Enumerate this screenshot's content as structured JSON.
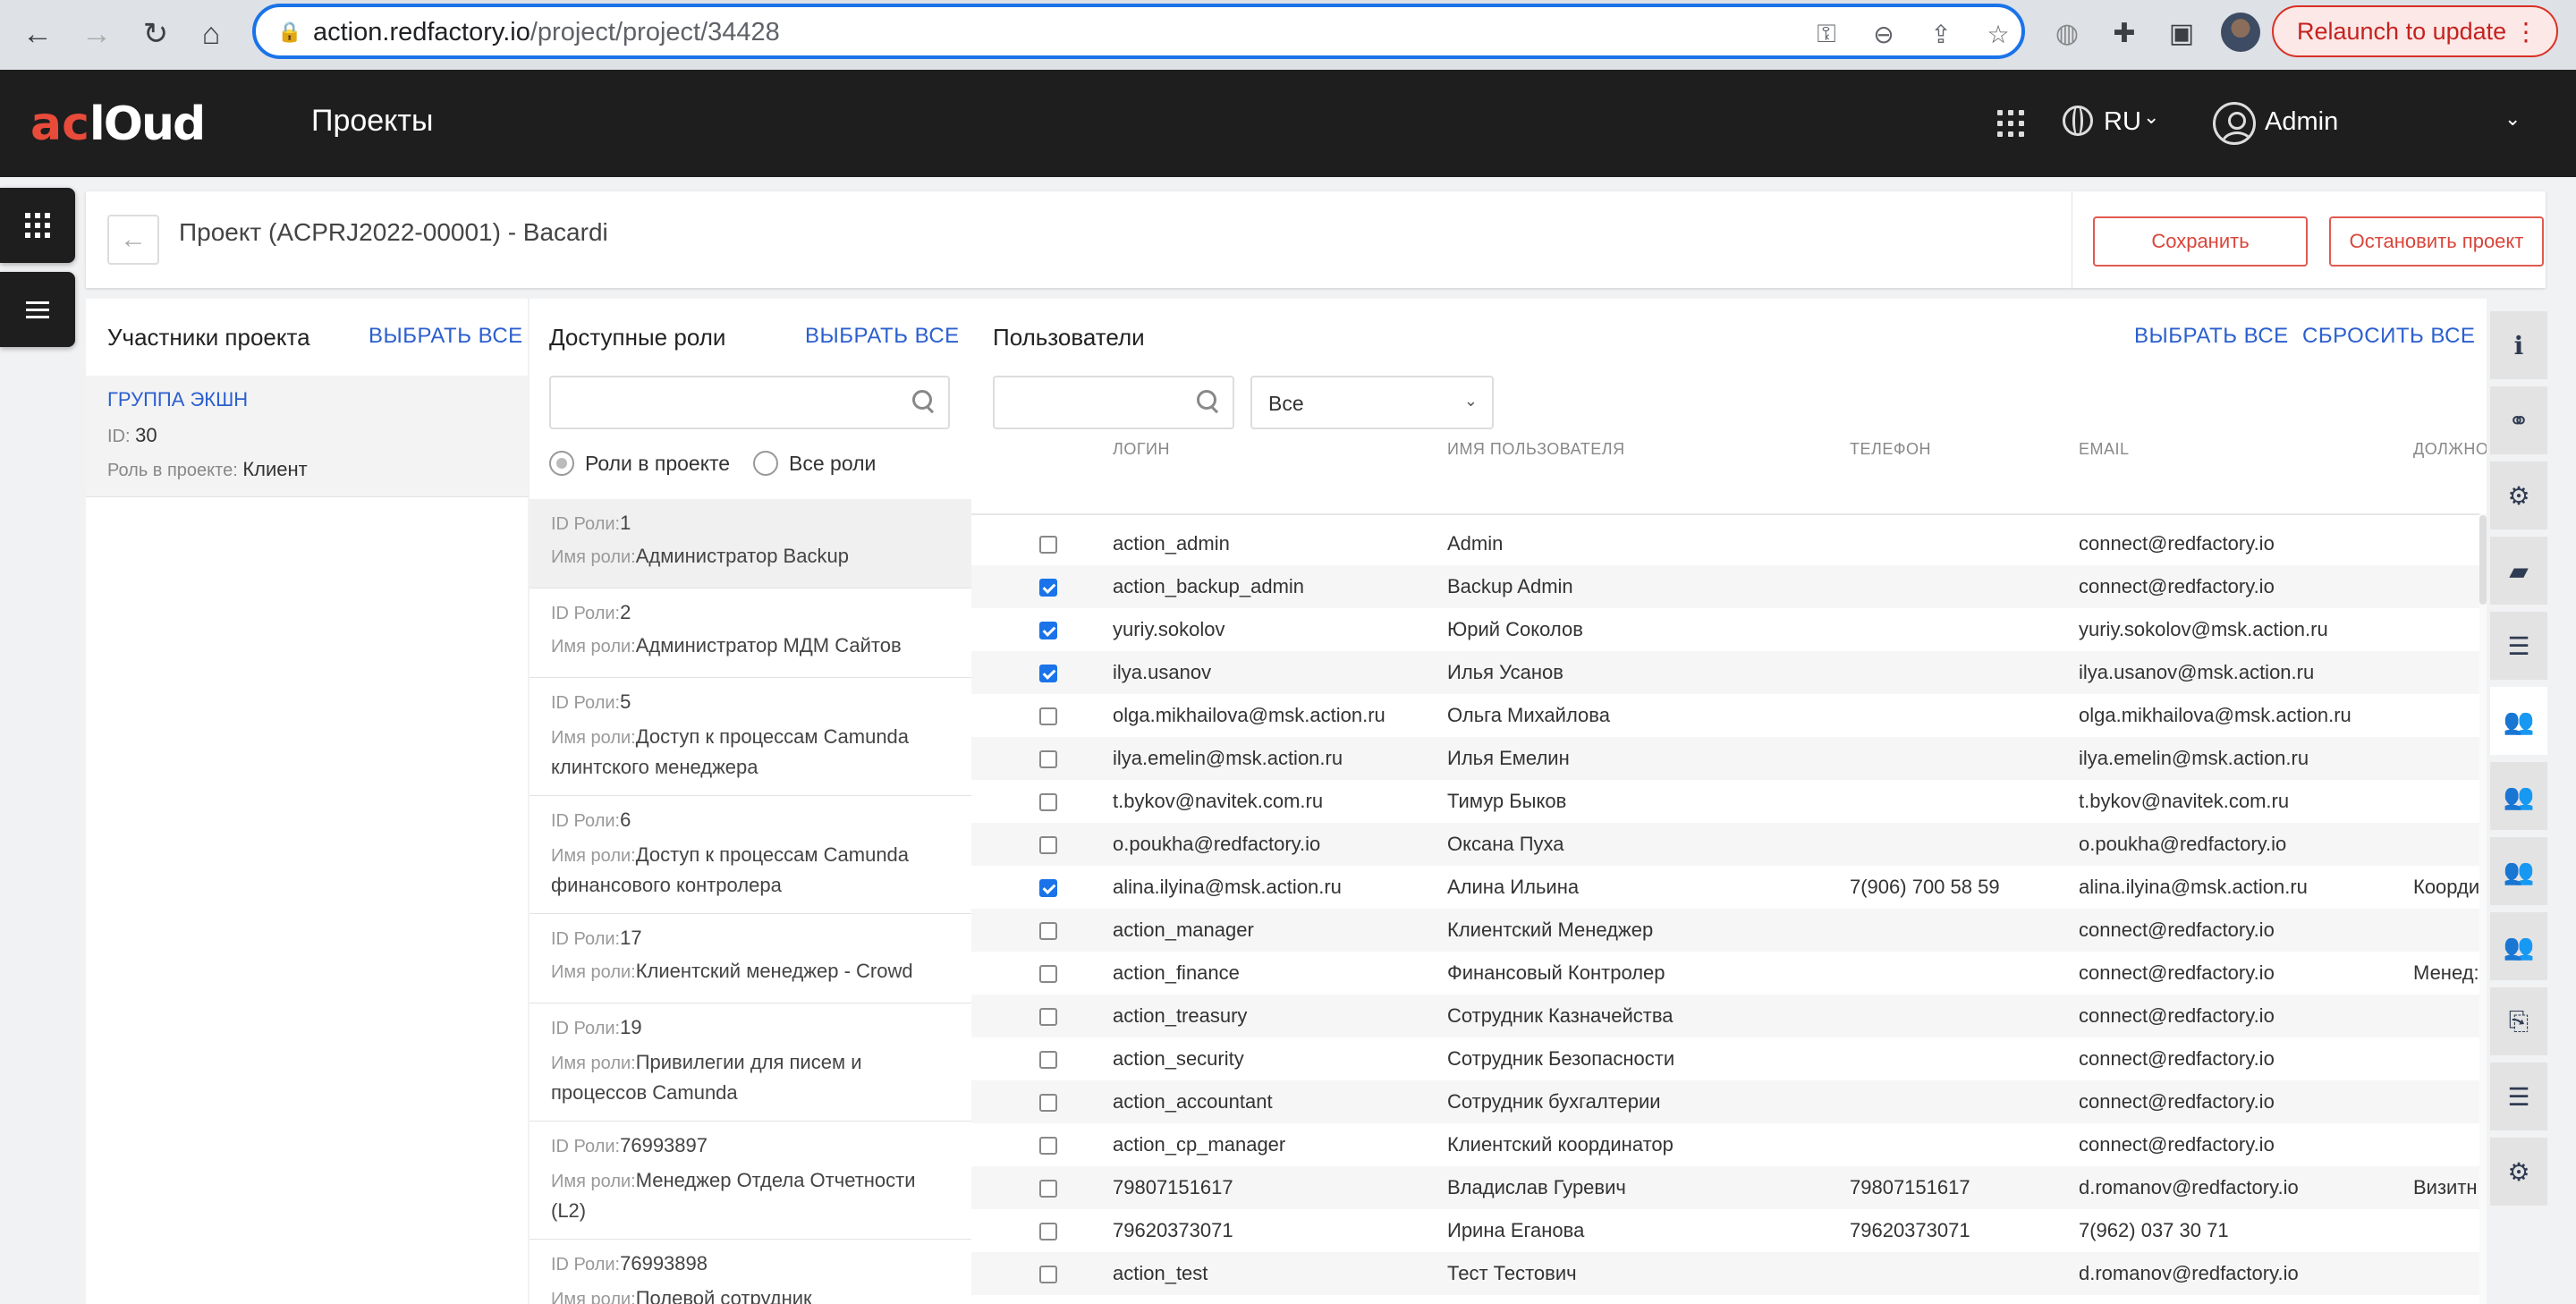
{
  "browser": {
    "url_host": "action.redfactory.io",
    "url_path": "/project/project/34428",
    "relaunch_label": "Relaunch to update"
  },
  "app": {
    "logo_left": "ac",
    "logo_right": "lOud",
    "title": "Проекты",
    "lang": "RU",
    "user": "Admin"
  },
  "page": {
    "title": "Проект (ACPRJ2022-00001) - Bacardi",
    "save_label": "Сохранить",
    "stop_label": "Остановить проект"
  },
  "members": {
    "heading": "Участники проекта",
    "select_all": "ВЫБРАТЬ ВСЕ",
    "items": [
      {
        "name": "ГРУППА ЭКШН",
        "id_label": "ID:",
        "id": "30",
        "role_label": "Роль в проекте:",
        "role": "Клиент"
      }
    ]
  },
  "roles": {
    "heading": "Доступные роли",
    "select_all": "ВЫБРАТЬ ВСЕ",
    "radio_project": "Роли в проекте",
    "radio_all": "Все роли",
    "id_label": "ID Роли:",
    "name_label": "Имя роли:",
    "items": [
      {
        "id": "1",
        "name": "Администратор Backup"
      },
      {
        "id": "2",
        "name": "Администратор МДМ Сайтов"
      },
      {
        "id": "5",
        "name": "Доступ к процессам Camunda клинтского менеджера"
      },
      {
        "id": "6",
        "name": "Доступ к процессам Camunda финансового контролера"
      },
      {
        "id": "17",
        "name": "Клиентский менеджер - Crowd"
      },
      {
        "id": "19",
        "name": "Привилегии для писем и процессов Camunda"
      },
      {
        "id": "76993897",
        "name": "Менеджер Отдела Отчетности (L2)"
      },
      {
        "id": "76993898",
        "name": "Полевой сотрудник"
      }
    ]
  },
  "users": {
    "heading": "Пользователи",
    "select_all": "ВЫБРАТЬ ВСЕ",
    "reset_all": "СБРОСИТЬ ВСЕ",
    "filter_value": "Все",
    "columns": [
      "ЛОГИН",
      "ИМЯ ПОЛЬЗОВАТЕЛЯ",
      "ТЕЛЕФОН",
      "EMAIL",
      "ДОЛЖНО"
    ],
    "rows": [
      {
        "checked": false,
        "login": "action_admin",
        "name": "Admin",
        "phone": "",
        "email": "connect@redfactory.io",
        "position": ""
      },
      {
        "checked": true,
        "login": "action_backup_admin",
        "name": "Backup Admin",
        "phone": "",
        "email": "connect@redfactory.io",
        "position": ""
      },
      {
        "checked": true,
        "login": "yuriy.sokolov",
        "name": "Юрий Соколов",
        "phone": "",
        "email": "yuriy.sokolov@msk.action.ru",
        "position": ""
      },
      {
        "checked": true,
        "login": "ilya.usanov",
        "name": "Илья Усанов",
        "phone": "",
        "email": "ilya.usanov@msk.action.ru",
        "position": ""
      },
      {
        "checked": false,
        "login": "olga.mikhailova@msk.action.ru",
        "name": "Ольга Михайлова",
        "phone": "",
        "email": "olga.mikhailova@msk.action.ru",
        "position": ""
      },
      {
        "checked": false,
        "login": "ilya.emelin@msk.action.ru",
        "name": "Илья Емелин",
        "phone": "",
        "email": "ilya.emelin@msk.action.ru",
        "position": ""
      },
      {
        "checked": false,
        "login": "t.bykov@navitek.com.ru",
        "name": "Тимур Быков",
        "phone": "",
        "email": "t.bykov@navitek.com.ru",
        "position": ""
      },
      {
        "checked": false,
        "login": "o.poukha@redfactory.io",
        "name": "Оксана Пуха",
        "phone": "",
        "email": "o.poukha@redfactory.io",
        "position": ""
      },
      {
        "checked": true,
        "login": "alina.ilyina@msk.action.ru",
        "name": "Алина Ильина",
        "phone": "7(906) 700 58 59",
        "email": "alina.ilyina@msk.action.ru",
        "position": "Коорди"
      },
      {
        "checked": false,
        "login": "action_manager",
        "name": "Клиентский Менеджер",
        "phone": "",
        "email": "connect@redfactory.io",
        "position": ""
      },
      {
        "checked": false,
        "login": "action_finance",
        "name": "Финансовый Контролер",
        "phone": "",
        "email": "connect@redfactory.io",
        "position": "Менед:"
      },
      {
        "checked": false,
        "login": "action_treasury",
        "name": "Сотрудник Казначейства",
        "phone": "",
        "email": "connect@redfactory.io",
        "position": ""
      },
      {
        "checked": false,
        "login": "action_security",
        "name": "Сотрудник Безопасности",
        "phone": "",
        "email": "connect@redfactory.io",
        "position": ""
      },
      {
        "checked": false,
        "login": "action_accountant",
        "name": "Сотрудник бухгалтерии",
        "phone": "",
        "email": "connect@redfactory.io",
        "position": ""
      },
      {
        "checked": false,
        "login": "action_cp_manager",
        "name": "Клиентский координатор",
        "phone": "",
        "email": "connect@redfactory.io",
        "position": ""
      },
      {
        "checked": false,
        "login": "79807151617",
        "name": "Владислав Гуревич",
        "phone": "79807151617",
        "email": "d.romanov@redfactory.io",
        "position": "Визитн"
      },
      {
        "checked": false,
        "login": "79620373071",
        "name": "Ирина Еганова",
        "phone": "79620373071",
        "email": "7(962) 037 30 71",
        "position": ""
      },
      {
        "checked": false,
        "login": "action_test",
        "name": "Тест Тестович",
        "phone": "",
        "email": "d.romanov@redfactory.io",
        "position": ""
      }
    ]
  },
  "sidebar_icons": [
    "info-icon",
    "handshake-icon",
    "gear-icon",
    "folder-icon",
    "list-icon",
    "users-icon",
    "group-icon",
    "group-icon",
    "group-icon",
    "paperclip-icon",
    "list-icon",
    "settings-icon"
  ],
  "colors": {
    "accent": "#2b5fcf",
    "danger": "#d9453a",
    "header": "#1e1e1e",
    "active_icon": "#b5344b"
  }
}
